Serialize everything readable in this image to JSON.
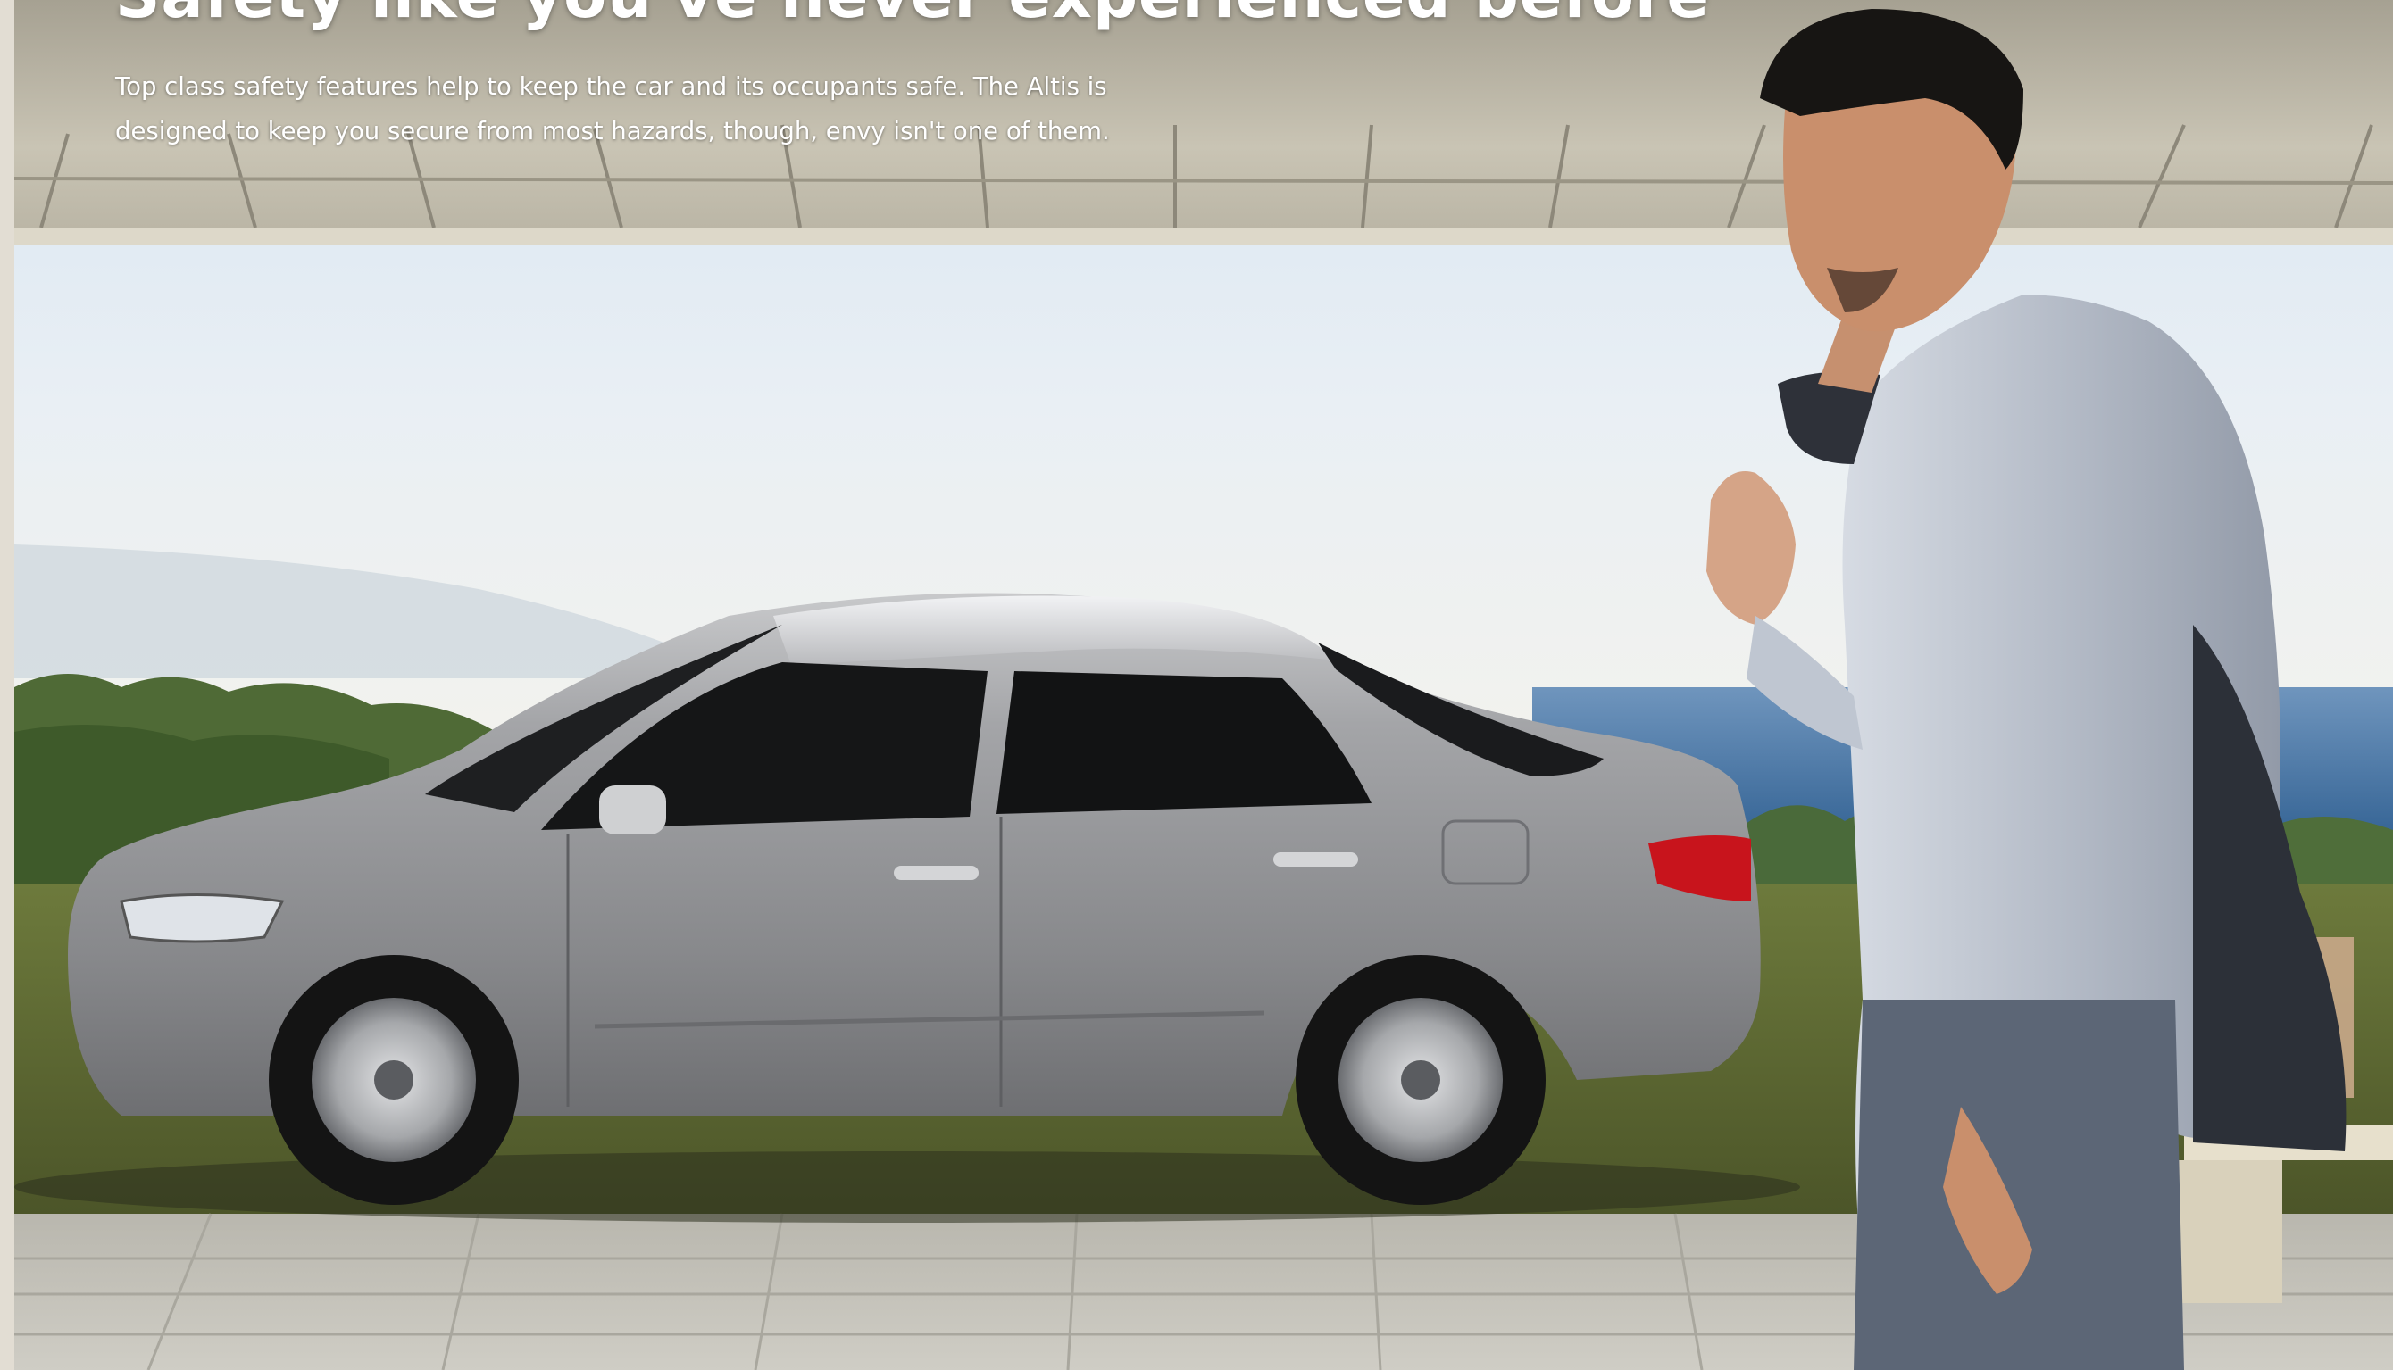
{
  "hero": {
    "headline": "Safety like you've never experienced before",
    "intro": "Top class safety features help to keep the car and its occupants safe. The Altis is designed to keep you secure from most hazards, though, envy isn't one of them."
  },
  "colors": {
    "headline_text": "#ffffff",
    "body_text": "#ffffff",
    "sky_top": "#dfe9f3",
    "sea": "#3f6f9c",
    "car_body": "#8f8f91",
    "tail_light": "#c8141c",
    "shirt": "#b4bbc6",
    "trousers": "#5c6676",
    "paving": "#c2c0b8",
    "left_strip": "#e2ddd3"
  }
}
